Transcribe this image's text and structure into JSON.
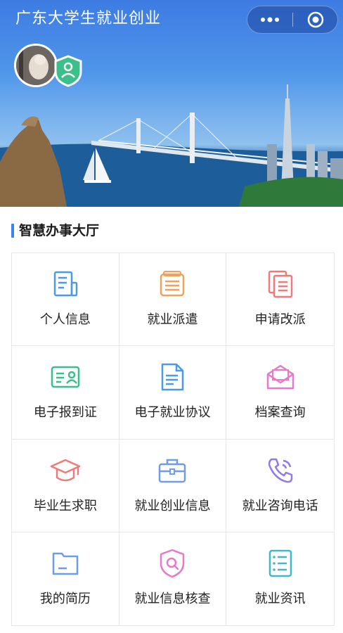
{
  "app": {
    "title": "广东大学生就业创业"
  },
  "section": {
    "title": "智慧办事大厅"
  },
  "services": [
    {
      "label": "个人信息",
      "icon": "personal-info-icon",
      "color": "#4a9ae8"
    },
    {
      "label": "就业派遣",
      "icon": "dispatch-icon",
      "color": "#f0a15a"
    },
    {
      "label": "申请改派",
      "icon": "reassign-icon",
      "color": "#f07a7a"
    },
    {
      "label": "电子报到证",
      "icon": "e-report-card-icon",
      "color": "#36c08a"
    },
    {
      "label": "电子就业协议",
      "icon": "e-agreement-icon",
      "color": "#4a9ae8"
    },
    {
      "label": "档案查询",
      "icon": "archive-mail-icon",
      "color": "#e879c9"
    },
    {
      "label": "毕业生求职",
      "icon": "graduation-cap-icon",
      "color": "#f07a7a"
    },
    {
      "label": "就业创业信息",
      "icon": "briefcase-icon",
      "color": "#6f9be8"
    },
    {
      "label": "就业咨询电话",
      "icon": "phone-icon",
      "color": "#8f7ae8"
    },
    {
      "label": "我的简历",
      "icon": "folder-icon",
      "color": "#6f9be8"
    },
    {
      "label": "就业信息核查",
      "icon": "shield-search-icon",
      "color": "#e879c9"
    },
    {
      "label": "就业资讯",
      "icon": "news-list-icon",
      "color": "#3fb8c7"
    }
  ]
}
